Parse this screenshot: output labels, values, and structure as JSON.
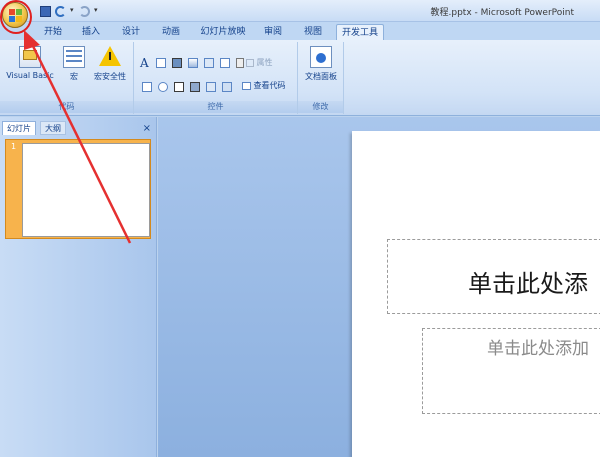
{
  "window": {
    "title": "教程.pptx - Microsoft PowerPoint"
  },
  "tabs": [
    "开始",
    "插入",
    "设计",
    "动画",
    "幻灯片放映",
    "审阅",
    "视图",
    "开发工具"
  ],
  "active_tab": "开发工具",
  "ribbon": {
    "code_group": {
      "label": "代码",
      "visual_basic": "Visual Basic",
      "macro": "宏",
      "macro_security": "宏安全性"
    },
    "controls_group": {
      "label": "控件",
      "properties": "属性",
      "view_code": "查看代码"
    },
    "modify_group": {
      "label": "修改",
      "document_panel": "文档面板"
    }
  },
  "left_panel": {
    "tab_slides": "幻灯片",
    "tab_outline": "大纲",
    "close": "×",
    "slide_number": "1"
  },
  "slide": {
    "title_placeholder": "单击此处添",
    "subtitle_placeholder": "单击此处添加"
  },
  "colors": {
    "accent": "#f7b34c",
    "annotation": "#e02020"
  }
}
